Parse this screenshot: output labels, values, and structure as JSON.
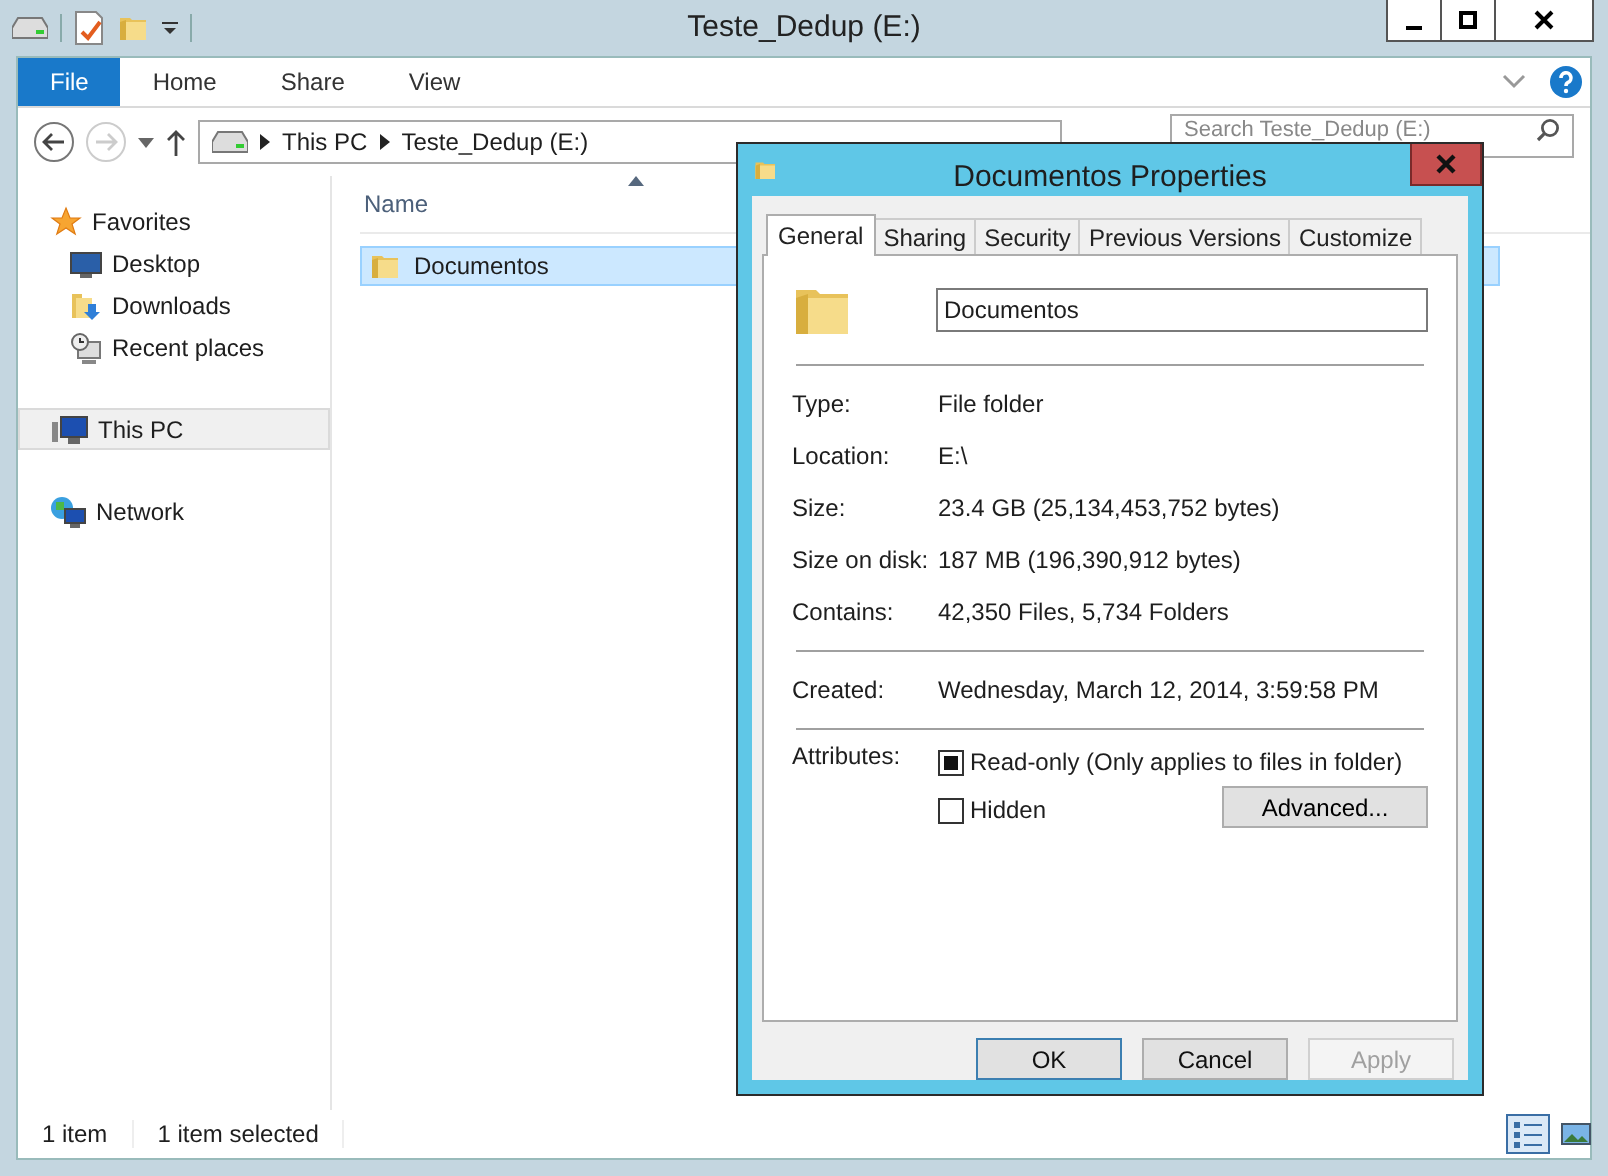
{
  "window": {
    "title": "Teste_Dedup (E:)"
  },
  "ribbon": {
    "tabs": [
      {
        "label": "File",
        "selected": true
      },
      {
        "label": "Home",
        "selected": false
      },
      {
        "label": "Share",
        "selected": false
      },
      {
        "label": "View",
        "selected": false
      }
    ]
  },
  "address_bar": {
    "path": [
      "This PC",
      "Teste_Dedup (E:)"
    ]
  },
  "search": {
    "placeholder": "Search Teste_Dedup (E:)"
  },
  "sidebar": {
    "items": [
      {
        "label": "Favorites",
        "kind": "star",
        "selected": false,
        "children": [
          {
            "label": "Desktop",
            "kind": "desktop",
            "selected": false
          },
          {
            "label": "Downloads",
            "kind": "downloads",
            "selected": false
          },
          {
            "label": "Recent places",
            "kind": "recent",
            "selected": false
          }
        ]
      },
      {
        "label": "This PC",
        "kind": "pc",
        "selected": true
      },
      {
        "label": "Network",
        "kind": "network",
        "selected": false
      }
    ]
  },
  "file_list": {
    "columns": [
      "Name"
    ],
    "rows": [
      {
        "name": "Documentos",
        "selected": true
      }
    ]
  },
  "status_bar": {
    "items": [
      "1 item",
      "1 item selected"
    ],
    "views": [
      {
        "kind": "details",
        "selected": true
      },
      {
        "kind": "tiles",
        "selected": false
      }
    ]
  },
  "dialog": {
    "title": "Documentos Properties",
    "tabs": [
      {
        "label": "General",
        "selected": true
      },
      {
        "label": "Sharing",
        "selected": false
      },
      {
        "label": "Security",
        "selected": false
      },
      {
        "label": "Previous Versions",
        "selected": false
      },
      {
        "label": "Customize",
        "selected": false
      }
    ],
    "name_field": {
      "value": "Documentos"
    },
    "sections": [
      [
        {
          "label": "Type:",
          "value": "File folder"
        },
        {
          "label": "Location:",
          "value": "E:\\"
        },
        {
          "label": "Size:",
          "value": "23.4 GB (25,134,453,752 bytes)"
        },
        {
          "label": "Size on disk:",
          "value": "187 MB (196,390,912 bytes)"
        },
        {
          "label": "Contains:",
          "value": "42,350 Files, 5,734 Folders"
        }
      ],
      [
        {
          "label": "Created:",
          "value": "Wednesday, March 12, 2014, 3:59:58 PM"
        }
      ]
    ],
    "attributes": {
      "label": "Attributes:",
      "options": [
        {
          "label": "Read-only (Only applies to files in folder)",
          "checked": false,
          "indeterminate": true
        },
        {
          "label": "Hidden",
          "checked": false,
          "indeterminate": false
        }
      ],
      "advanced": "Advanced..."
    },
    "buttons": [
      {
        "label": "OK",
        "default": true,
        "disabled": false
      },
      {
        "label": "Cancel",
        "default": false,
        "disabled": false
      },
      {
        "label": "Apply",
        "default": false,
        "disabled": true
      }
    ]
  }
}
